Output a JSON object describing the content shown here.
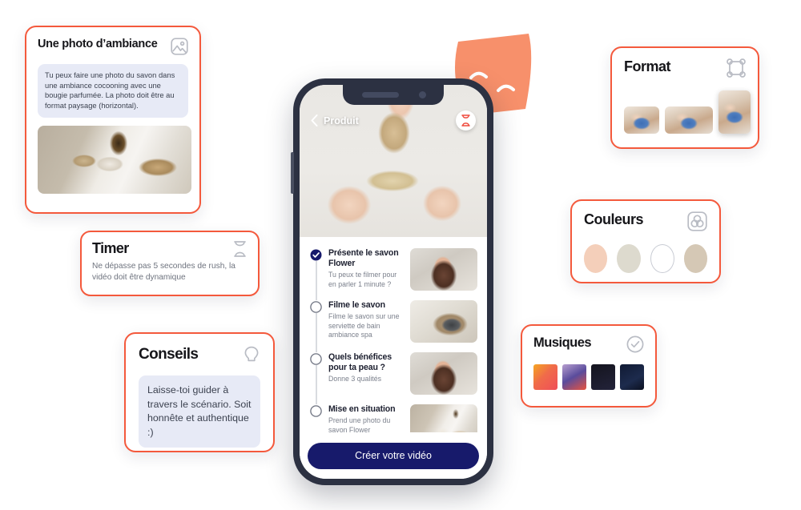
{
  "cards": {
    "ambiance": {
      "title": "Une photo d’ambiance",
      "icon": "image-icon",
      "body": "Tu peux faire une photo du savon dans une ambiance cocooning avec une bougie parfumée. La photo doit être au format paysage (horizontal).",
      "photo_alt": "Photo d’ambiance salle de bain"
    },
    "timer": {
      "title": "Timer",
      "icon": "hourglass-icon",
      "body": "Ne dépasse pas 5 secondes de rush, la vidéo doit être dynamique"
    },
    "conseils": {
      "title": "Conseils",
      "icon": "lightbulb-icon",
      "body": "Laisse-toi guider à travers le scénario. Soit honnête et authentique :)"
    },
    "format": {
      "title": "Format",
      "icon": "crop-frame-icon",
      "thumbnails": [
        {
          "name": "format-landscape-small",
          "alt": "Poterie paysage"
        },
        {
          "name": "format-landscape-wide",
          "alt": "Poterie paysage large"
        },
        {
          "name": "format-portrait-selected",
          "alt": "Poterie portrait"
        }
      ]
    },
    "couleurs": {
      "title": "Couleurs",
      "icon": "color-palette-icon",
      "swatches": [
        {
          "name": "swatch-peach",
          "hex": "#f4cfba"
        },
        {
          "name": "swatch-sand",
          "hex": "#dddace"
        },
        {
          "name": "swatch-white",
          "hex": "#ffffff"
        },
        {
          "name": "swatch-taupe",
          "hex": "#d5c8b5"
        }
      ]
    },
    "musiques": {
      "title": "Musiques",
      "icon": "check-circle-icon",
      "albums": [
        {
          "name": "album-cover-1",
          "alt": "Pochette orange géométrique"
        },
        {
          "name": "album-cover-2",
          "alt": "Pochette violette casquette"
        },
        {
          "name": "album-cover-3",
          "alt": "Pochette Funky Giraffe"
        },
        {
          "name": "album-cover-4",
          "alt": "Pochette bleu nuit"
        }
      ]
    }
  },
  "phone": {
    "topbar": {
      "back_icon": "chevron-left-icon",
      "back_label": "Produit",
      "timer_icon": "hourglass-icon"
    },
    "hero_alt": "Main tenant un savon avec une brosse",
    "tasks": [
      {
        "state": "done",
        "title": "Présente le savon Flower",
        "subtitle": "Tu peux te filmer pour en parler 1 minute ?",
        "thumb": "thumb-portrait",
        "thumb_alt": "Portrait d’une femme"
      },
      {
        "state": "todo",
        "title": "Filme le savon",
        "subtitle": "Filme le savon sur une serviette de bain ambiance spa",
        "thumb": "thumb-soap",
        "thumb_alt": "Savon sur une serviette"
      },
      {
        "state": "todo",
        "title": "Quels bénéfices pour ta peau ?",
        "subtitle": "Donne 3 qualités",
        "thumb": "thumb-portrait",
        "thumb_alt": "Portrait d’une femme"
      },
      {
        "state": "todo",
        "title": "Mise en situation",
        "subtitle": "Prend une photo du savon Flower",
        "thumb": "thumb-spa",
        "thumb_alt": "Ambiance salle de bain"
      }
    ],
    "cta_label": "Créer votre vidéo"
  },
  "decoration": {
    "mask": "theatre-mask-shape"
  },
  "colors": {
    "card_border": "#f4593c",
    "accent_orange": "#f7906b",
    "cta_navy": "#171a6b",
    "bubble_bg": "#e7eaf6",
    "phone_frame": "#2c3142"
  }
}
